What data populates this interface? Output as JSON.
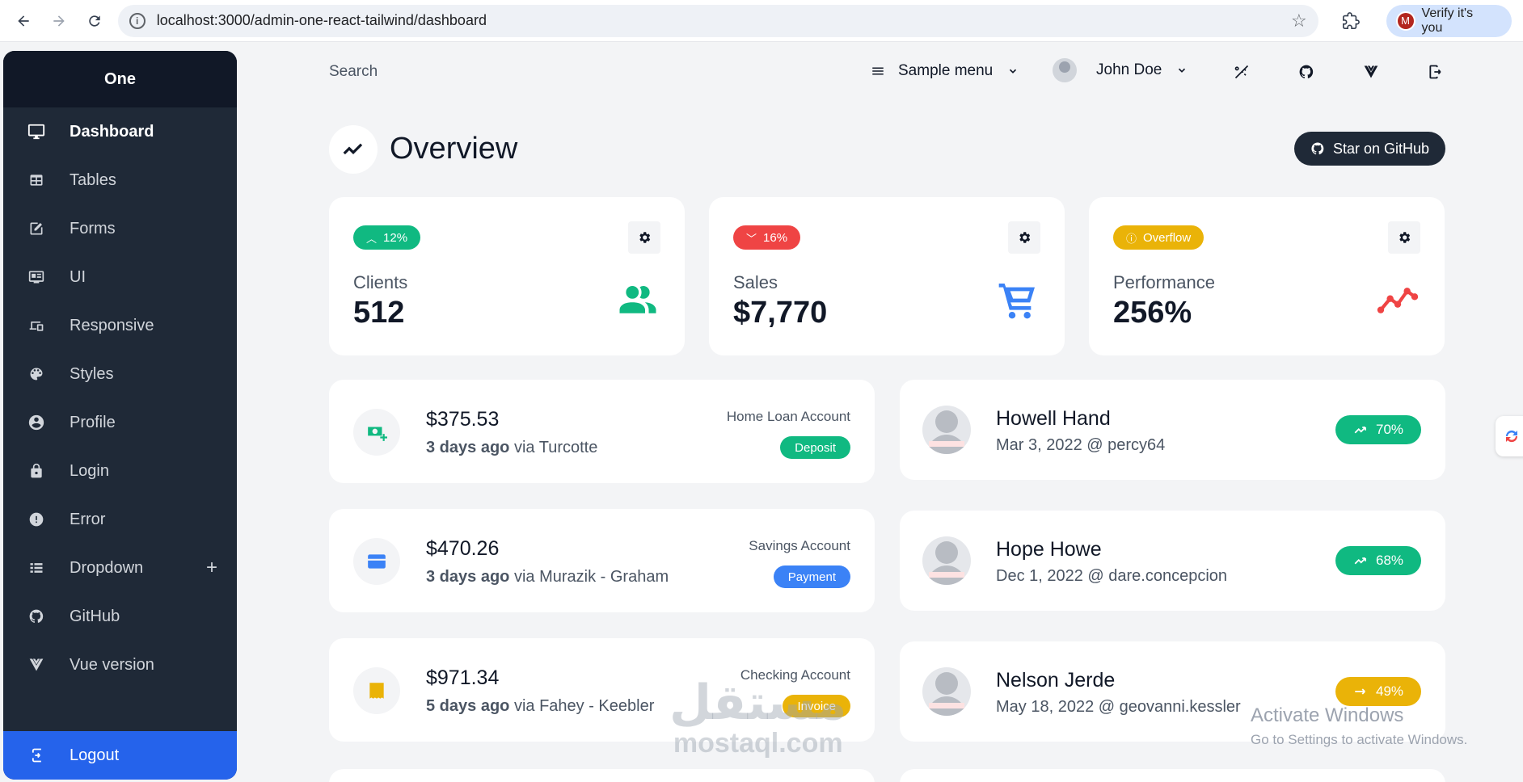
{
  "browser": {
    "url": "localhost:3000/admin-one-react-tailwind/dashboard",
    "profile_label": "Verify it's you",
    "profile_initial": "M"
  },
  "sidebar": {
    "brand": "One",
    "items": [
      {
        "label": "Dashboard",
        "icon": "monitor-icon",
        "active": true
      },
      {
        "label": "Tables",
        "icon": "table-icon"
      },
      {
        "label": "Forms",
        "icon": "edit-square-icon"
      },
      {
        "label": "UI",
        "icon": "tv-guide-icon"
      },
      {
        "label": "Responsive",
        "icon": "responsive-icon"
      },
      {
        "label": "Styles",
        "icon": "palette-icon"
      },
      {
        "label": "Profile",
        "icon": "account-circle-icon"
      },
      {
        "label": "Login",
        "icon": "lock-icon"
      },
      {
        "label": "Error",
        "icon": "alert-circle-icon"
      },
      {
        "label": "Dropdown",
        "icon": "view-list-icon",
        "expand": "+"
      },
      {
        "label": "GitHub",
        "icon": "github-icon"
      },
      {
        "label": "Vue version",
        "icon": "vue-icon"
      }
    ],
    "logout_label": "Logout"
  },
  "topbar": {
    "search_placeholder": "Search",
    "menu_label": "Sample menu",
    "user_name": "John Doe"
  },
  "overview": {
    "title": "Overview",
    "star_button": "Star on GitHub"
  },
  "stats": [
    {
      "badge": "12%",
      "badge_icon": "chevron-up-icon",
      "badge_color": "#10b981",
      "label": "Clients",
      "value": "512",
      "icon": "account-multiple-icon",
      "icon_color": "#10b981"
    },
    {
      "badge": "16%",
      "badge_icon": "chevron-down-icon",
      "badge_color": "#ef4444",
      "label": "Sales",
      "value": "$7,770",
      "icon": "cart-icon",
      "icon_color": "#3b82f6"
    },
    {
      "badge": "Overflow",
      "badge_icon": "alert-circle-outline-icon",
      "badge_color": "#eab308",
      "label": "Performance",
      "value": "256%",
      "icon": "chart-timeline-icon",
      "icon_color": "#ef4444"
    }
  ],
  "transactions": [
    {
      "amount": "$375.53",
      "when": "3 days ago",
      "via": "via Turcotte",
      "account": "Home Loan Account",
      "type": "Deposit",
      "type_color": "#10b981",
      "icon": "cash-plus-icon",
      "icon_color": "#10b981"
    },
    {
      "amount": "$470.26",
      "when": "3 days ago",
      "via": "via Murazik - Graham",
      "account": "Savings Account",
      "type": "Payment",
      "type_color": "#3b82f6",
      "icon": "credit-card-icon",
      "icon_color": "#3b82f6"
    },
    {
      "amount": "$971.34",
      "when": "5 days ago",
      "via": "via Fahey - Keebler",
      "account": "Checking Account",
      "type": "Invoice",
      "type_color": "#eab308",
      "icon": "receipt-icon",
      "icon_color": "#eab308"
    }
  ],
  "clients": [
    {
      "name": "Howell Hand",
      "meta": "Mar 3, 2022 @ percy64",
      "trend": "70%",
      "trend_icon": "trending-up-icon",
      "trend_color": "#10b981"
    },
    {
      "name": "Hope Howe",
      "meta": "Dec 1, 2022 @ dare.concepcion",
      "trend": "68%",
      "trend_icon": "trending-up-icon",
      "trend_color": "#10b981"
    },
    {
      "name": "Nelson Jerde",
      "meta": "May 18, 2022 @ geovanni.kessler",
      "trend": "49%",
      "trend_icon": "trending-neutral-icon",
      "trend_color": "#eab308"
    }
  ],
  "os_overlay": {
    "line1": "Activate Windows",
    "line2": "Go to Settings to activate Windows."
  },
  "watermark": {
    "arabic": "مستقل",
    "latin": "mostaql.com"
  }
}
